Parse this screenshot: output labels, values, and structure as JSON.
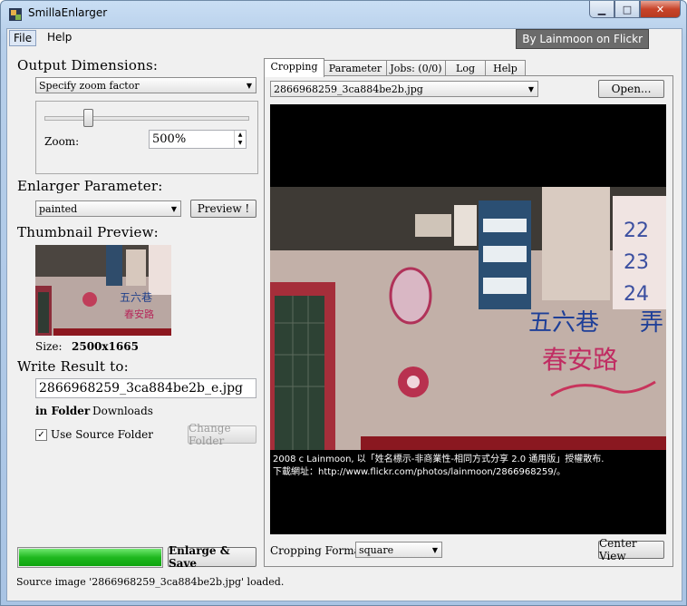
{
  "window": {
    "title": "SmillaEnlarger"
  },
  "menu": {
    "file": "File",
    "help": "Help"
  },
  "tooltip": "By Lainmoon on Flickr",
  "left": {
    "output_heading": "Output Dimensions:",
    "mode_select": "Specify zoom factor",
    "zoom_label": "Zoom:",
    "zoom_value": "500%",
    "zoom_slider_fraction": 0.2,
    "enlarger_heading": "Enlarger Parameter:",
    "preset_select": "painted",
    "preview_button": "Preview !",
    "thumb_heading": "Thumbnail Preview:",
    "size_label": "Size:",
    "size_value": "2500x1665",
    "write_heading": "Write Result to:",
    "output_filename": "2866968259_3ca884be2b_e.jpg",
    "in_folder_label": "in Folder",
    "folder_value": "Downloads",
    "use_source_folder": "Use Source Folder",
    "change_folder_button": "Change Folder",
    "progress_fraction": 1.0,
    "enlarge_button": "Enlarge & Save"
  },
  "tabs": [
    "Cropping",
    "Parameter",
    "Jobs: (0/0)",
    "Log",
    "Help"
  ],
  "cropping": {
    "file_select": "2866968259_3ca884be2b.jpg",
    "open_button": "Open...",
    "credit_line1": "2008 c Lainmoon, 以「姓名標示-非商業性-相同方式分享  2.0 通用版」授權散布.",
    "credit_line2": "下載網址：http://www.flickr.com/photos/lainmoon/2866968259/。",
    "format_label": "Cropping Format:",
    "format_select": "square",
    "center_button": "Center View"
  },
  "status": "Source image '2866968259_3ca884be2b.jpg' loaded."
}
